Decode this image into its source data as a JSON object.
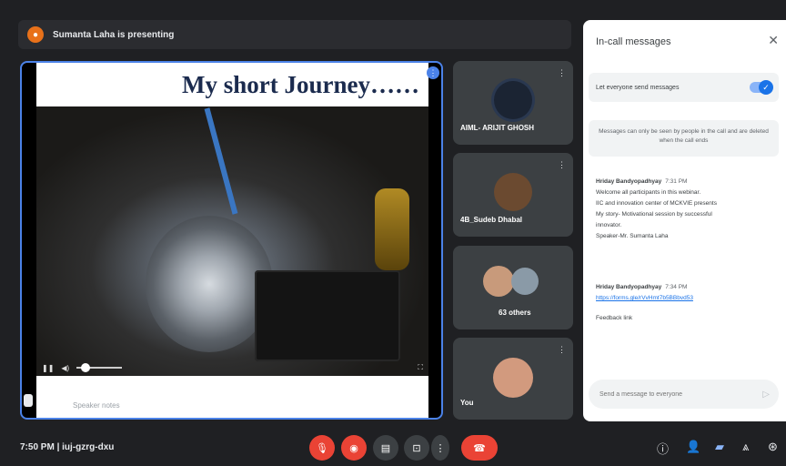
{
  "presenting_bar": {
    "text": "Sumanta Laha is presenting"
  },
  "stage": {
    "slide_title": "My short Journey……",
    "video": {
      "progress": 0.2
    },
    "notes_placeholder": "Speaker notes"
  },
  "participants": [
    {
      "name": "AIML- ARIJIT GHOSH"
    },
    {
      "name": "4B_Sudeb Dhabal"
    },
    {
      "name": "63 others"
    },
    {
      "name": "You"
    }
  ],
  "panel": {
    "title": "In-call messages",
    "toggle_label": "Let everyone send messages",
    "toggle_on": true,
    "info": "Messages can only be seen by people in the call and are deleted when the call ends",
    "messages": [
      {
        "sender": "Hriday Bandyopadhyay",
        "time": "7:31 PM",
        "lines": [
          "Welcome all participants in this webinar.",
          "IIC and innovation center of MCKVIE presents",
          "My story- Motivational session by successful",
          "innovator.",
          "Speaker-Mr. Sumanta Laha"
        ]
      },
      {
        "sender": "Hriday Bandyopadhyay",
        "time": "7:34 PM",
        "link": "https://forms.gle/rVvHmt7b5BBbvd53",
        "extra": "Feedback link"
      }
    ],
    "send_placeholder": "Send a message to everyone"
  },
  "bottom": {
    "time": "7:50 PM",
    "meeting_code": "iuj-gzrg-dxu"
  }
}
